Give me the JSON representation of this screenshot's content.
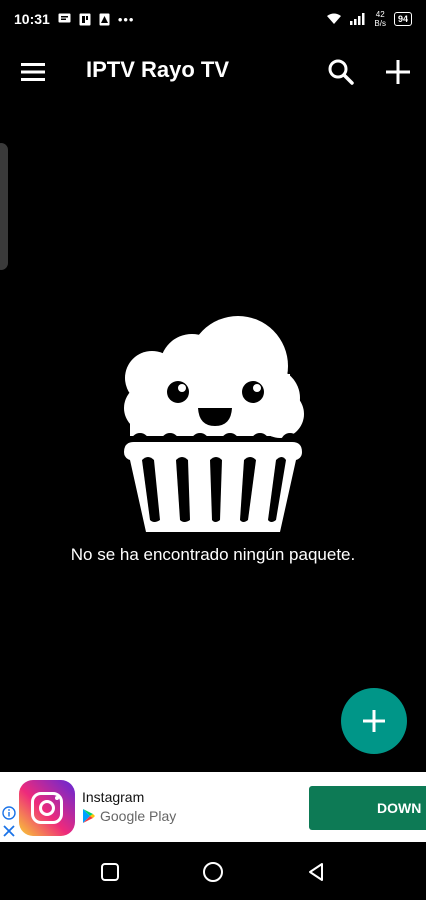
{
  "status_bar": {
    "time": "10:31",
    "dots": "•••",
    "net_speed_value": "42",
    "net_speed_unit": "B/s",
    "battery": "94",
    "icons": [
      "message-icon",
      "portrait-icon",
      "photo-icon",
      "wifi-icon",
      "signal-icon",
      "battery-icon"
    ]
  },
  "app_bar": {
    "title": "IPTV Rayo TV",
    "icons": [
      "menu-icon",
      "search-icon",
      "plus-icon"
    ]
  },
  "empty_state": {
    "message": "No se ha encontrado ningún paquete.",
    "illustration": "cupcake-icon"
  },
  "fab": {
    "icon": "plus-icon",
    "color": "#009688"
  },
  "ad": {
    "app_name": "Instagram",
    "store": "Google Play",
    "cta": "DOWN",
    "cta_color": "#0d7a55",
    "icons": [
      "info-icon",
      "close-icon",
      "instagram-logo",
      "google-play-icon"
    ]
  },
  "nav_bar": {
    "icons": [
      "recents-icon",
      "home-icon",
      "back-icon"
    ]
  }
}
